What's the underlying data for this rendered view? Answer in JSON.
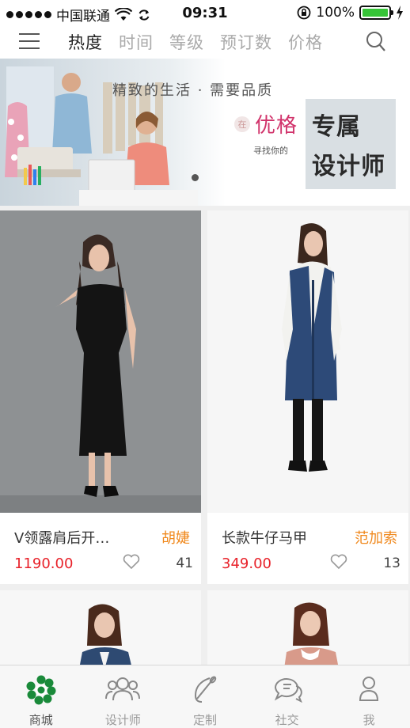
{
  "status_bar": {
    "carrier": "中国联通",
    "time": "09:31",
    "battery": "100%",
    "battery_level": 1.0
  },
  "tabs": [
    "热度",
    "时间",
    "等级",
    "预订数",
    "价格"
  ],
  "active_tab_index": 0,
  "banner": {
    "slogan": "精致的生活 · 需要品质",
    "brand_seal": "在",
    "brand_name": "优格",
    "sub": "寻找你的",
    "tag_line1": "专属",
    "tag_line2": "设计师"
  },
  "products": [
    {
      "title": "V领露肩后开…",
      "designer": "胡婕",
      "price": "1190.00",
      "likes": "41"
    },
    {
      "title": "长款牛仔马甲",
      "designer": "范加索",
      "price": "349.00",
      "likes": "13"
    },
    {
      "title": "",
      "designer": "",
      "price": "",
      "likes": ""
    },
    {
      "title": "",
      "designer": "",
      "price": "",
      "likes": ""
    }
  ],
  "bottom_nav": [
    {
      "label": "商城",
      "icon": "mall-icon"
    },
    {
      "label": "设计师",
      "icon": "designers-icon"
    },
    {
      "label": "定制",
      "icon": "custom-needle-icon"
    },
    {
      "label": "社交",
      "icon": "chat-bubbles-icon"
    },
    {
      "label": "我",
      "icon": "person-icon"
    }
  ],
  "colors": {
    "accent_price": "#e8222a",
    "designer": "#f0891e",
    "brand_pink": "#d1336b",
    "nav_active": "#1a8a3a",
    "battery": "#36c437"
  }
}
